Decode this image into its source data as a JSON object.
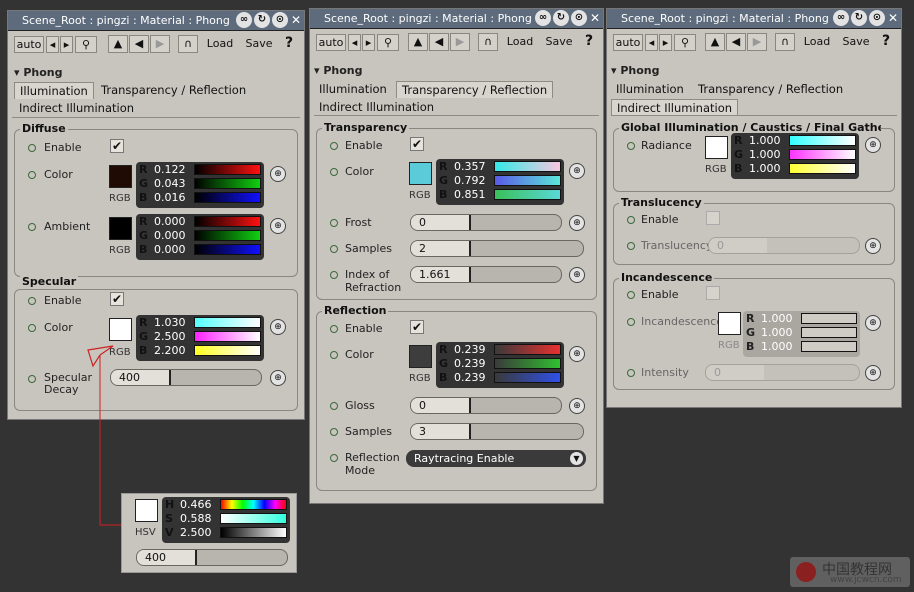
{
  "common": {
    "title": "Scene_Root : pingzi : Material : Phong",
    "auto_label": "auto",
    "load_label": "Load",
    "save_label": "Save",
    "help_label": "?",
    "phong_label": "Phong",
    "tabs": [
      "Illumination",
      "Transparency / Reflection",
      "Indirect Illumination"
    ]
  },
  "illumination": {
    "diffuse": {
      "title": "Diffuse",
      "enable_label": "Enable",
      "color_label": "Color",
      "color_rgb": [
        "0.122",
        "0.043",
        "0.016"
      ],
      "ambient_label": "Ambient",
      "ambient_rgb": [
        "0.000",
        "0.000",
        "0.000"
      ]
    },
    "specular": {
      "title": "Specular",
      "enable_label": "Enable",
      "color_label": "Color",
      "color_rgb": [
        "1.030",
        "2.500",
        "2.200"
      ],
      "decay_label_1": "Specular",
      "decay_label_2": "Decay",
      "decay_value": "400"
    },
    "rgb_label": "RGB",
    "hsv_popup": {
      "hsv": [
        "0.466",
        "0.588",
        "2.500"
      ],
      "hsv_label": "HSV",
      "value": "400"
    }
  },
  "transparency": {
    "title": "Transparency",
    "enable_label": "Enable",
    "color_label": "Color",
    "color_rgb": [
      "0.357",
      "0.792",
      "0.851"
    ],
    "frost_label": "Frost",
    "frost_value": "0",
    "samples_label": "Samples",
    "samples_value": "2",
    "ior_label_1": "Index of",
    "ior_label_2": "Refraction",
    "ior_value": "1.661"
  },
  "reflection": {
    "title": "Reflection",
    "enable_label": "Enable",
    "color_label": "Color",
    "color_rgb": [
      "0.239",
      "0.239",
      "0.239"
    ],
    "gloss_label": "Gloss",
    "gloss_value": "0",
    "samples_label": "Samples",
    "samples_value": "3",
    "mode_label_1": "Reflection",
    "mode_label_2": "Mode",
    "mode_value": "Raytracing Enable"
  },
  "indirect": {
    "gi_title": "Global Illumination / Caustics / Final Gatheri...",
    "radiance_label": "Radiance",
    "radiance_rgb": [
      "1.000",
      "1.000",
      "1.000"
    ],
    "translucency_title": "Translucency",
    "enable_label": "Enable",
    "translucency_label": "Translucency",
    "translucency_value": "0",
    "incandescence_title": "Incandescence",
    "incandescence_label": "Incandescence",
    "incandescence_rgb": [
      "1.000",
      "1.000",
      "1.000"
    ],
    "intensity_label": "Intensity",
    "intensity_value": "0"
  },
  "watermark": {
    "text": "中国教程网",
    "url": "www.jcwcn.com"
  },
  "colors": {
    "diffuse": "#1f0b04",
    "ambient": "#000000",
    "specular": "#ffffff",
    "transparency": "#5bcad9",
    "reflection": "#3d3d3d",
    "radiance": "#ffffff",
    "incandescence": "#ffffff",
    "callout": "#cc2222"
  }
}
